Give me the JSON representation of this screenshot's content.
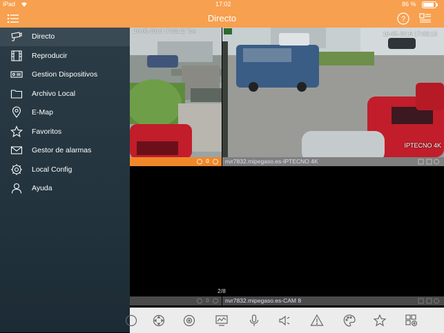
{
  "status_bar": {
    "device": "iPad",
    "time": "17:02",
    "battery": "86 %"
  },
  "nav": {
    "title": "Directo"
  },
  "sidebar": {
    "items": [
      {
        "label": "Directo",
        "icon": "camera-icon",
        "active": true
      },
      {
        "label": "Reproducir",
        "icon": "film-icon"
      },
      {
        "label": "Gestion Dispositivos",
        "icon": "device-icon"
      },
      {
        "label": "Archivo Local",
        "icon": "folder-icon"
      },
      {
        "label": "E-Map",
        "icon": "map-pin-icon"
      },
      {
        "label": "Favoritos",
        "icon": "star-icon"
      },
      {
        "label": "Gestor de alarmas",
        "icon": "alarm-mail-icon"
      },
      {
        "label": "Local Config",
        "icon": "gear-icon"
      },
      {
        "label": "Ayuda",
        "icon": "user-icon"
      }
    ]
  },
  "video": {
    "cam1_timestamp": "10-05-2016 17:02:12 Tue",
    "cam2_timestamp": "10-05-2016 17:02:13",
    "cam2_overlay": "IPTECNO 4K",
    "cam2_label": "nvr7832.mipegaso.es-IPTECNO 4K",
    "cam4_label": "nvr7832.mipegaso.es-CAM 8",
    "page_indicator": "2/8"
  },
  "colors": {
    "accent": "#f7a04f",
    "sidebar": "#263740",
    "active_label": "#f0882a"
  }
}
